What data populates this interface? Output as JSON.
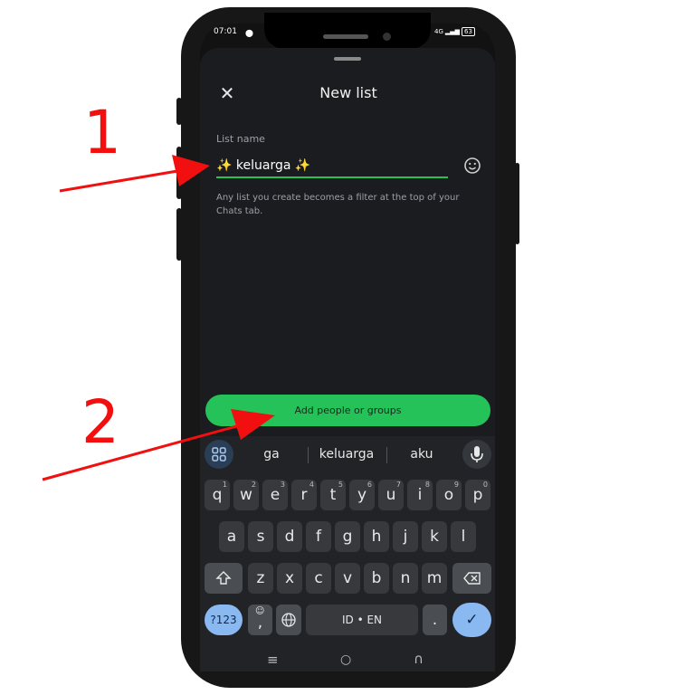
{
  "status": {
    "time": "07:01",
    "network": "4G",
    "battery": "63"
  },
  "header": {
    "title": "New list"
  },
  "list_name": {
    "label": "List name",
    "value": "✨ keluarga ✨"
  },
  "helper_text": "Any list you create becomes a filter at the top of your Chats tab.",
  "cta_label": "Add people or groups",
  "suggestions": [
    "ga",
    "keluarga",
    "aku"
  ],
  "keyboard": {
    "row1": [
      {
        "k": "q",
        "n": "1"
      },
      {
        "k": "w",
        "n": "2"
      },
      {
        "k": "e",
        "n": "3"
      },
      {
        "k": "r",
        "n": "4"
      },
      {
        "k": "t",
        "n": "5"
      },
      {
        "k": "y",
        "n": "6"
      },
      {
        "k": "u",
        "n": "7"
      },
      {
        "k": "i",
        "n": "8"
      },
      {
        "k": "o",
        "n": "9"
      },
      {
        "k": "p",
        "n": "0"
      }
    ],
    "row2": [
      "a",
      "s",
      "d",
      "f",
      "g",
      "h",
      "j",
      "k",
      "l"
    ],
    "row3": [
      "z",
      "x",
      "c",
      "v",
      "b",
      "n",
      "m"
    ],
    "symbols_label": "?123",
    "comma": ",",
    "space_label": "ID • EN",
    "period": "."
  },
  "annotations": {
    "one": "1",
    "two": "2"
  },
  "colors": {
    "accent": "#25c25a",
    "arrow": "#f20f0f",
    "enter_key": "#8ab8f0"
  }
}
